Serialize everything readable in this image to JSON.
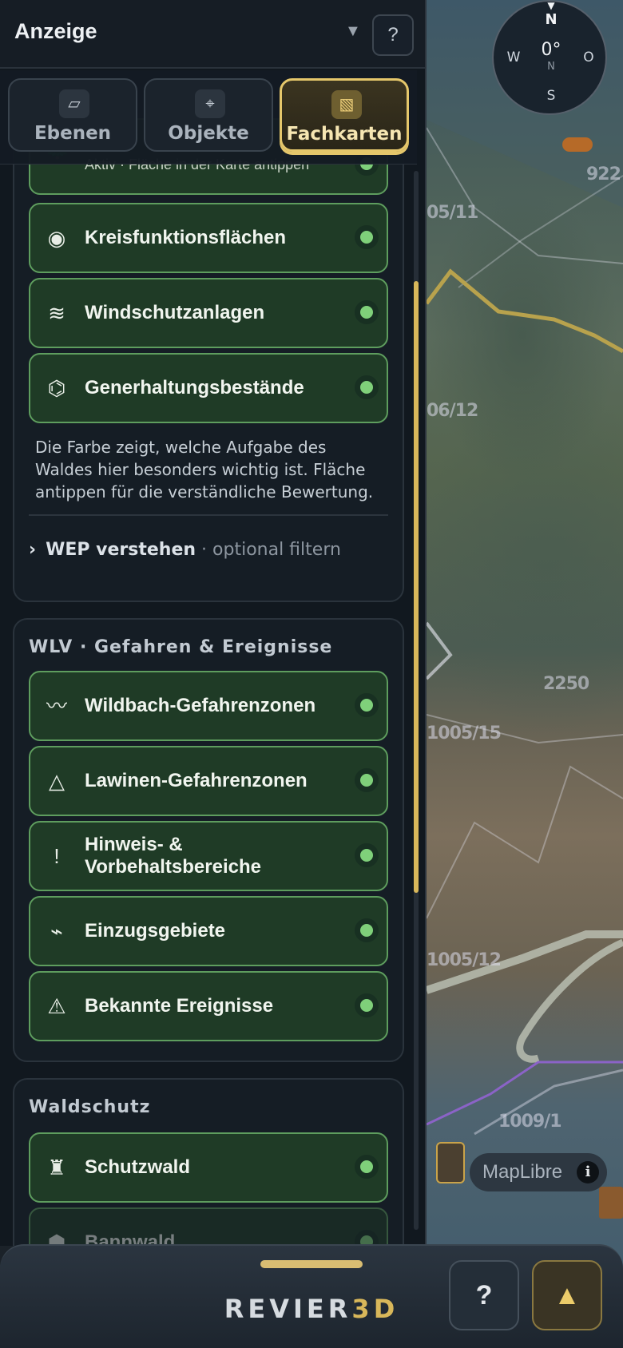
{
  "panel": {
    "title": "Anzeige",
    "dropdown_arrow": "▼",
    "help_label": "?"
  },
  "tabs": [
    {
      "label": "Ebenen",
      "icon": "▱",
      "icon_name": "layers-icon",
      "active": false
    },
    {
      "label": "Objekte",
      "icon": "⌖",
      "icon_name": "crosshair-icon",
      "active": false
    },
    {
      "label": "Fachkarten",
      "icon": "▧",
      "icon_name": "hatched-map-icon",
      "active": true
    }
  ],
  "wep_section": {
    "partial_item": {
      "icon": "🌲",
      "icon_name": "tree-icon",
      "subtitle": "Aktiv · Fläche in der Karte antippen",
      "status": "on"
    },
    "items": [
      {
        "label": "Kreisfunktionsflächen",
        "icon": "◉",
        "icon_name": "target-icon",
        "status": "on"
      },
      {
        "label": "Windschutzanlagen",
        "icon": "≋",
        "icon_name": "wind-icon",
        "status": "on"
      },
      {
        "label": "Generhaltungsbestände",
        "icon": "⌬",
        "icon_name": "hexagon-icon",
        "status": "on"
      }
    ],
    "description": "Die Farbe zeigt, welche Aufgabe des Waldes hier besonders wichtig ist. Fläche antippen für die verständliche Bewertung.",
    "expander": {
      "chevron": "›",
      "label": "WEP verstehen",
      "hint": "· optional filtern"
    }
  },
  "wlv_section": {
    "title": "WLV · Gefahren & Ereignisse",
    "items": [
      {
        "label": "Wildbach-Gefahrenzonen",
        "icon": "〰",
        "icon_name": "wave-icon",
        "status": "on"
      },
      {
        "label": "Lawinen-Gefahrenzonen",
        "icon": "△",
        "icon_name": "triangle-icon",
        "status": "on"
      },
      {
        "label": "Hinweis- & Vorbehaltsbereiche",
        "icon": "!",
        "icon_name": "exclamation-icon",
        "status": "on"
      },
      {
        "label": "Einzugsgebiete",
        "icon": "⌁",
        "icon_name": "lightning-icon",
        "status": "on"
      },
      {
        "label": "Bekannte Ereignisse",
        "icon": "⚠",
        "icon_name": "warning-icon",
        "status": "on"
      }
    ]
  },
  "waldschutz_section": {
    "title": "Waldschutz",
    "items": [
      {
        "label": "Schutzwald",
        "icon": "♜",
        "icon_name": "castle-icon",
        "status": "on"
      },
      {
        "label": "Bannwald",
        "icon": "⬢",
        "icon_name": "hexagon-filled-icon",
        "status": "on"
      }
    ]
  },
  "map": {
    "labels": [
      "05/11",
      "06/12",
      "2250",
      "1005/15",
      "1005/12",
      "1009/1",
      "922"
    ],
    "attribution": "MapLibre",
    "info": "i"
  },
  "compass": {
    "north": "N",
    "south": "S",
    "west": "W",
    "east": "O",
    "heading": "0°",
    "sub": "N"
  },
  "bottom_bar": {
    "brand_part1": "REVIER",
    "brand_part2": "3D",
    "help_label": "?",
    "expand_label": "▲"
  },
  "colors": {
    "accent": "#d8b75a",
    "active_item_bg": "#1f3b26",
    "active_dot": "#7fd07a"
  }
}
